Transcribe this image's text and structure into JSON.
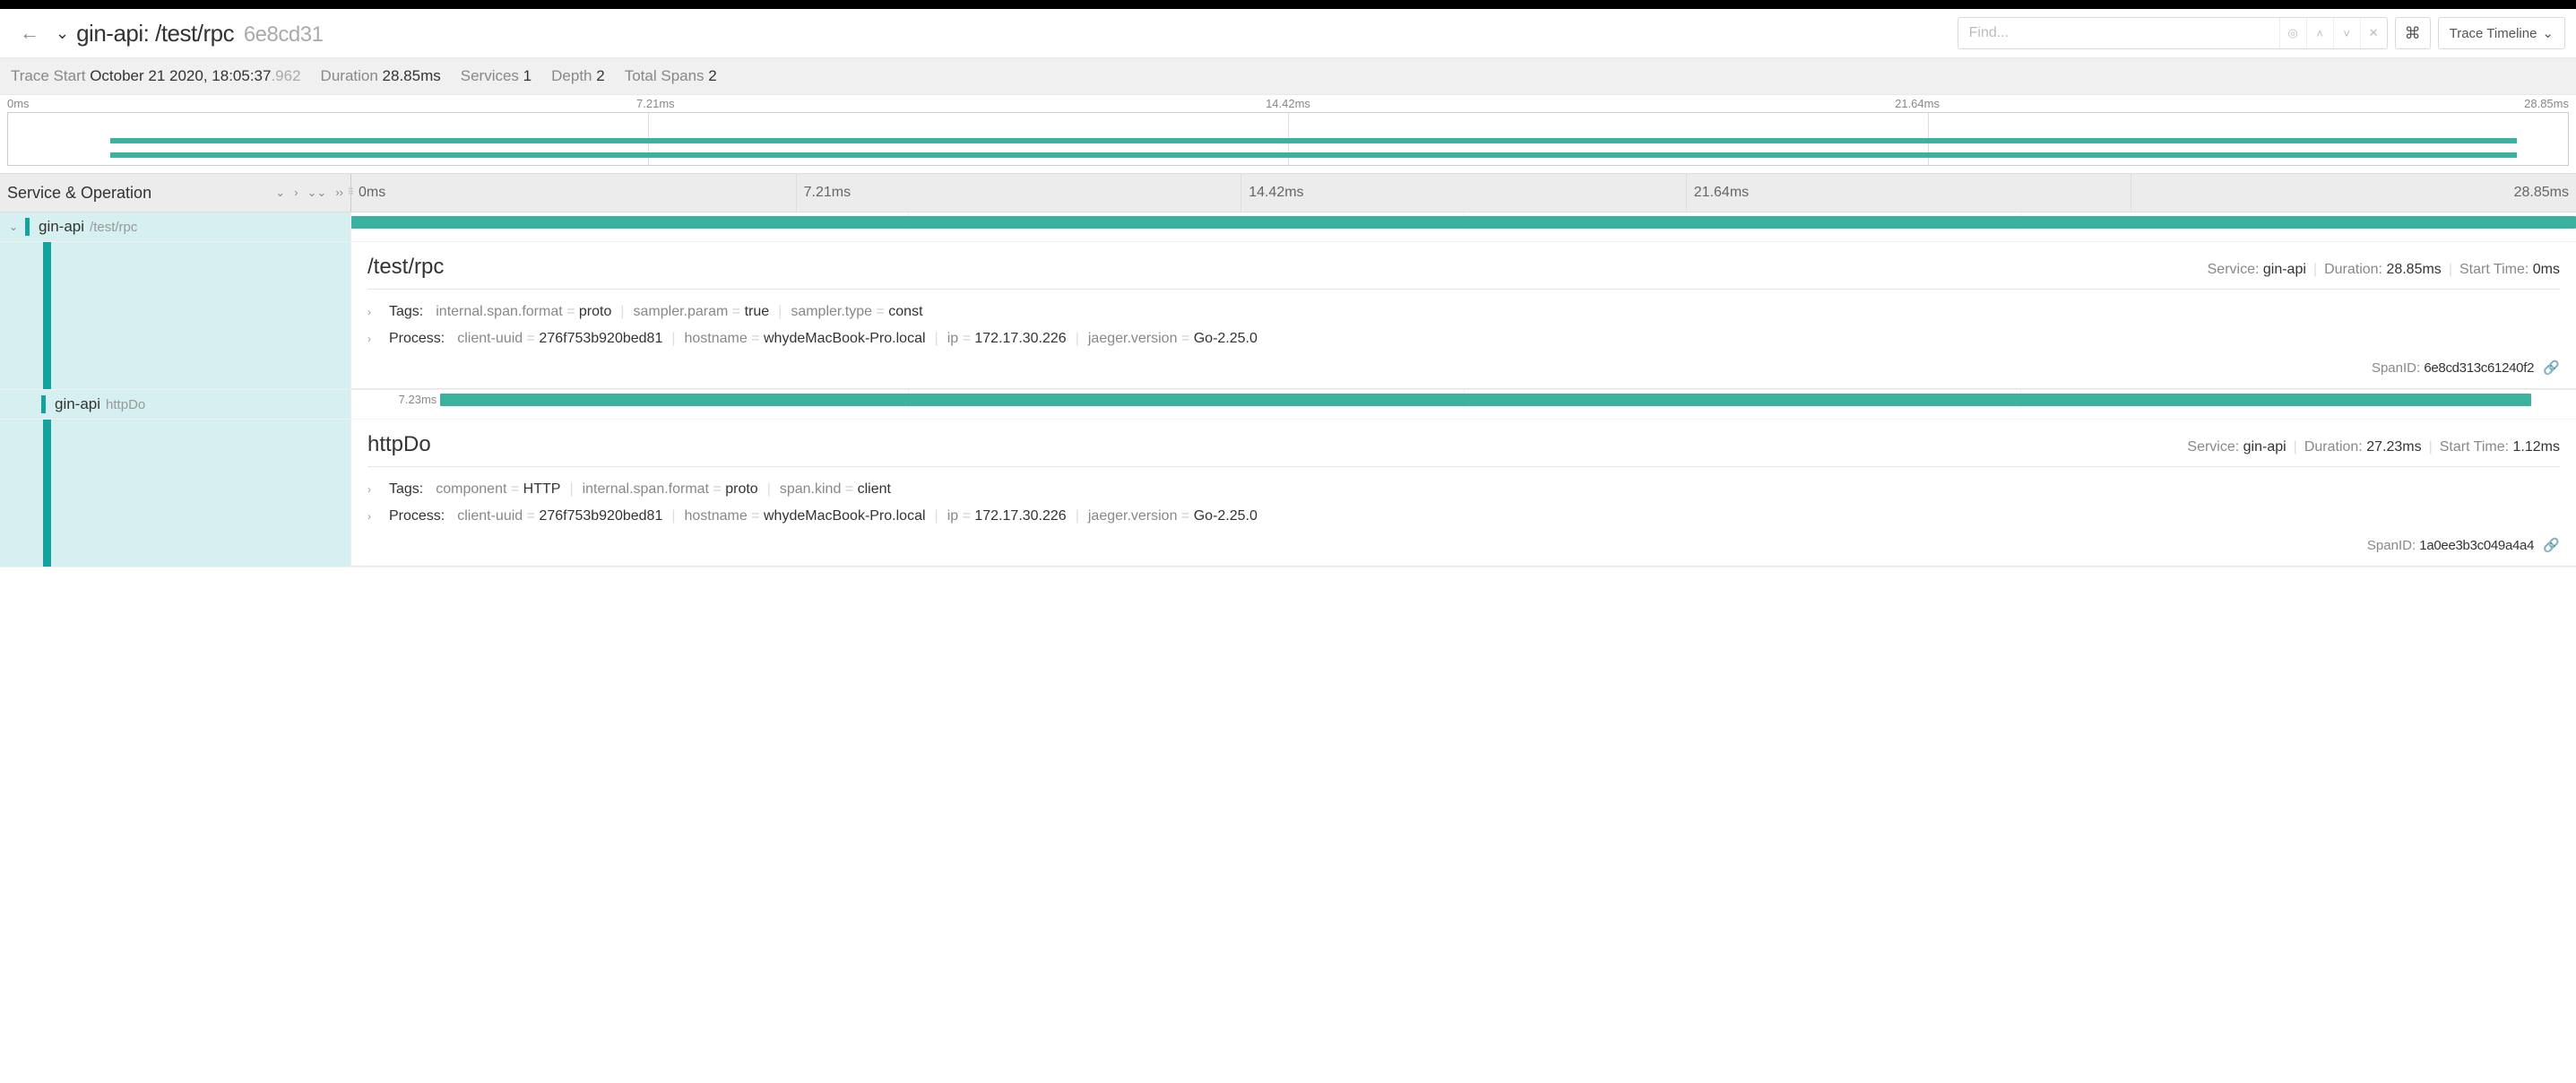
{
  "header": {
    "service_name": "gin-api",
    "operation": "/test/rpc",
    "trace_id": "6e8cd31",
    "search_placeholder": "Find...",
    "view_mode": "Trace Timeline"
  },
  "meta": {
    "trace_start_label": "Trace Start",
    "trace_start_main": "October 21 2020, 18:05:37",
    "trace_start_ms": ".962",
    "duration_label": "Duration",
    "duration": "28.85ms",
    "services_label": "Services",
    "services": "1",
    "depth_label": "Depth",
    "depth": "2",
    "total_spans_label": "Total Spans",
    "total_spans": "2"
  },
  "ticks": [
    "0ms",
    "7.21ms",
    "14.42ms",
    "21.64ms",
    "28.85ms"
  ],
  "service_op_header": "Service & Operation",
  "spans": [
    {
      "service": "gin-api",
      "operation": "/test/rpc",
      "indent": 0,
      "bar_left_pct": 0,
      "bar_width_pct": 100,
      "label": "",
      "detail": {
        "title": "/test/rpc",
        "service_label": "Service:",
        "service": "gin-api",
        "duration_label": "Duration:",
        "duration": "28.85ms",
        "start_label": "Start Time:",
        "start": "0ms",
        "tags_label": "Tags:",
        "tags": [
          {
            "k": "internal.span.format",
            "v": "proto"
          },
          {
            "k": "sampler.param",
            "v": "true"
          },
          {
            "k": "sampler.type",
            "v": "const"
          }
        ],
        "process_label": "Process:",
        "process": [
          {
            "k": "client-uuid",
            "v": "276f753b920bed81"
          },
          {
            "k": "hostname",
            "v": "whydeMacBook-Pro.local"
          },
          {
            "k": "ip",
            "v": "172.17.30.226"
          },
          {
            "k": "jaeger.version",
            "v": "Go-2.25.0"
          }
        ],
        "spanid_label": "SpanID:",
        "spanid": "6e8cd313c61240f2"
      }
    },
    {
      "service": "gin-api",
      "operation": "httpDo",
      "indent": 1,
      "bar_left_pct": 4,
      "bar_width_pct": 94,
      "label": "7.23ms",
      "detail": {
        "title": "httpDo",
        "service_label": "Service:",
        "service": "gin-api",
        "duration_label": "Duration:",
        "duration": "27.23ms",
        "start_label": "Start Time:",
        "start": "1.12ms",
        "tags_label": "Tags:",
        "tags": [
          {
            "k": "component",
            "v": "HTTP"
          },
          {
            "k": "internal.span.format",
            "v": "proto"
          },
          {
            "k": "span.kind",
            "v": "client"
          }
        ],
        "process_label": "Process:",
        "process": [
          {
            "k": "client-uuid",
            "v": "276f753b920bed81"
          },
          {
            "k": "hostname",
            "v": "whydeMacBook-Pro.local"
          },
          {
            "k": "ip",
            "v": "172.17.30.226"
          },
          {
            "k": "jaeger.version",
            "v": "Go-2.25.0"
          }
        ],
        "spanid_label": "SpanID:",
        "spanid": "1a0ee3b3c049a4a4"
      }
    }
  ]
}
